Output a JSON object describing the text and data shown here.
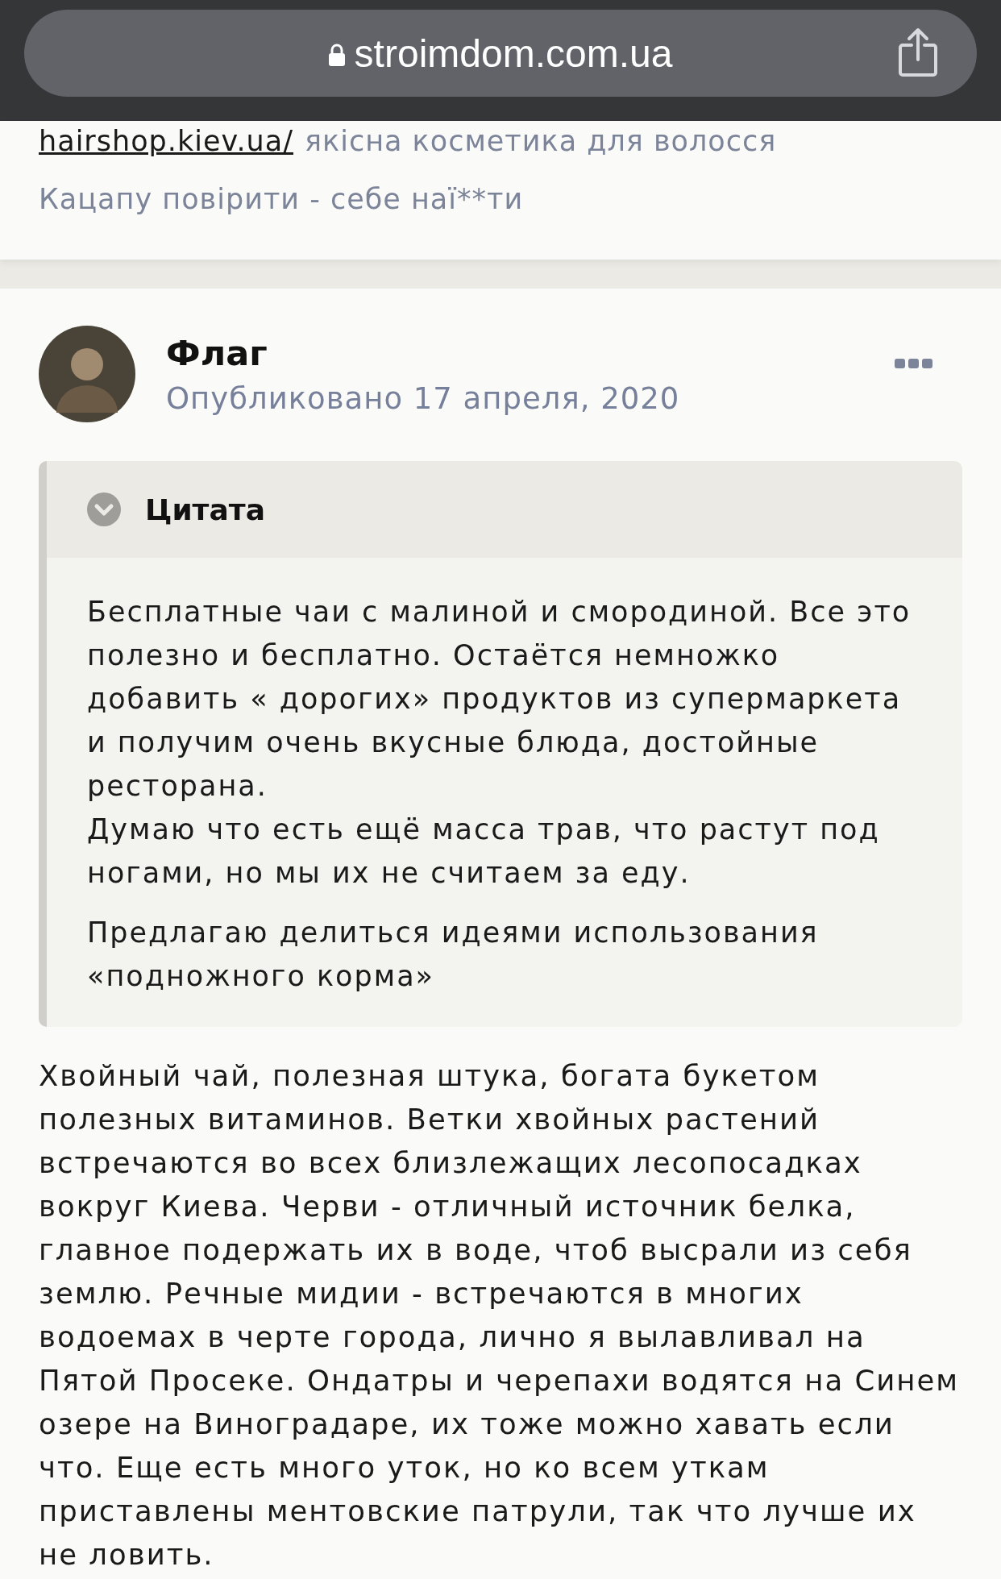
{
  "browser_bar": {
    "url": "stroimdom.com.ua"
  },
  "previous_post": {
    "signature_link": "hairshop.kiev.ua/",
    "signature_text": "якісна косметика для волосся",
    "signature_line": "Кацапу повірити - себе наї**ти"
  },
  "post": {
    "author": "Флаг",
    "date": "Опубликовано 17 апреля, 2020",
    "quote": {
      "title": "Цитата",
      "paragraphs": [
        {
          "lines": [
            "Бесплатные чаи с малиной и смородиной. Все это полезно и бесплатно. Остаётся немножко добавить « дорогих» продуктов из супермаркета и получим очень вкусные блюда, достойные ресторана.",
            "Думаю что есть ещё масса трав, что растут под ногами, но мы их не считаем за еду."
          ]
        },
        {
          "lines": [
            "Предлагаю делиться идеями использования «подножного корма»"
          ]
        }
      ]
    },
    "body": "Хвойный чай, полезная штука, богата букетом полезных витаминов. Ветки хвойных растений встречаются во всех близлежащих лесопосадках вокруг Киева. Черви - отличный источник белка, главное подержать их в воде, чтоб высрали из себя землю. Речные мидии - встречаются в многих водоемах в черте города, лично я вылавливал на Пятой Просеке. Ондатры и черепахи водятся на Синем озере на Виноградаре, их тоже можно хавать если что. Еще есть много уток, но ко всем уткам приставлены ментовские патрули, так что лучше их не ловить."
  }
}
